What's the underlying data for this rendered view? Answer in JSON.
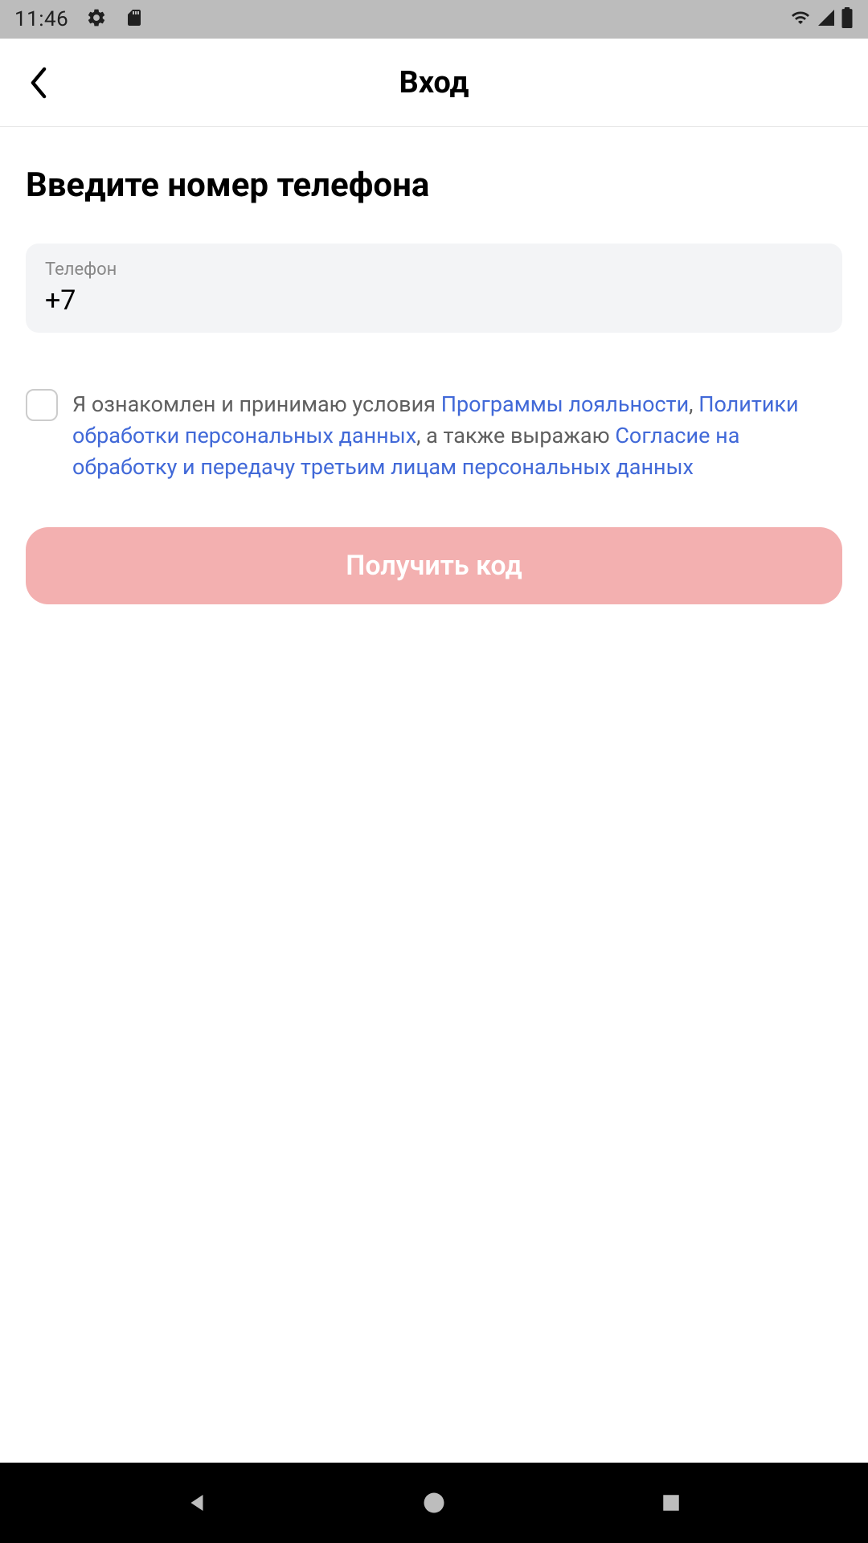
{
  "status_bar": {
    "time": "11:46"
  },
  "header": {
    "title": "Вход"
  },
  "main": {
    "heading": "Введите номер телефона",
    "phone_field": {
      "label": "Телефон",
      "value": "+7"
    },
    "consent": {
      "text_1": "Я ознакомлен и принимаю условия ",
      "link_1": "Программы лояльности",
      "text_2": ", ",
      "link_2": "Политики обработки персональных данных",
      "text_3": ", а также выражаю ",
      "link_3": "Согласие на обработку и передачу третьим лицам персональных данных"
    },
    "submit_label": "Получить код"
  }
}
